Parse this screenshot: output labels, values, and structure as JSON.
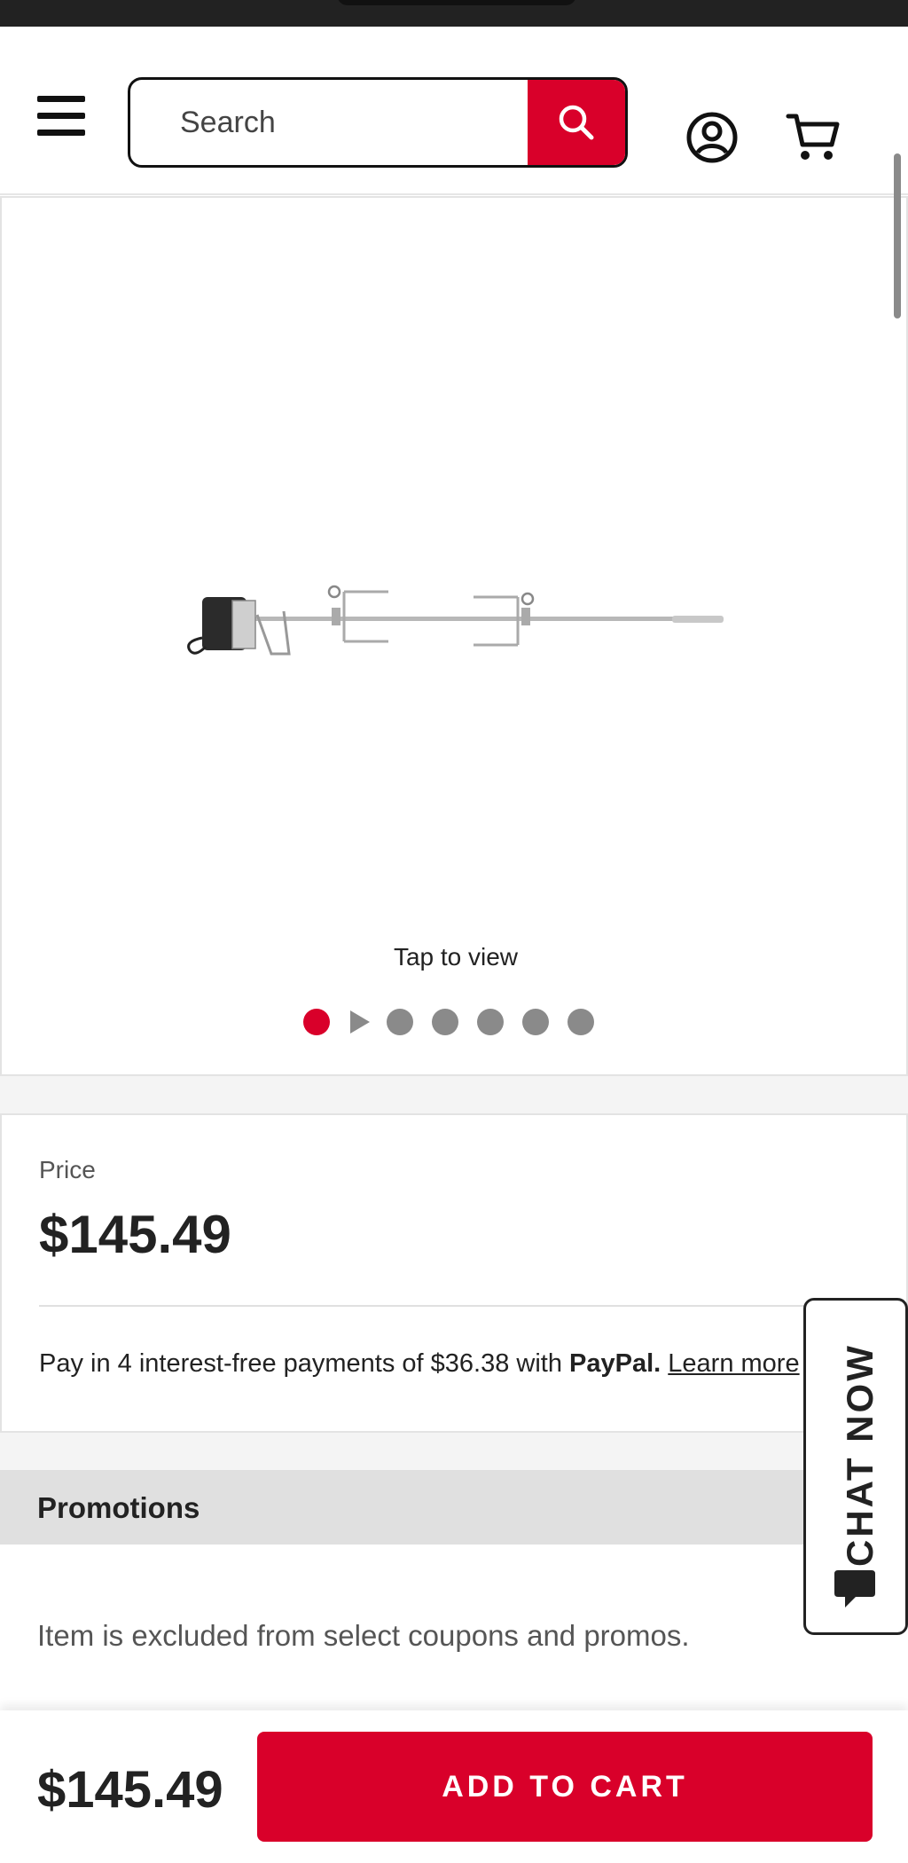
{
  "header": {
    "search_placeholder": "Search"
  },
  "gallery": {
    "tap_label": "Tap to view",
    "slide_count": 7,
    "active_slide": 1
  },
  "price_card": {
    "label": "Price",
    "price": "$145.49",
    "paypal": {
      "prefix": "Pay in 4 interest-free payments of $36.38 with ",
      "brand": "PayPal.",
      "learn_more": "Learn more"
    }
  },
  "promotions": {
    "title": "Promotions",
    "text": "Item is excluded from select coupons and promos."
  },
  "chat": {
    "label": "CHAT NOW"
  },
  "footer": {
    "price": "$145.49",
    "add_to_cart": "ADD TO CART"
  },
  "colors": {
    "accent": "#d9002a",
    "dot_inactive": "#8a8a8a",
    "section_gap": "#f4f4f4",
    "promo_header_bg": "#e0e0e0"
  },
  "icons": {
    "menu": "hamburger-menu-icon",
    "search": "search-icon",
    "account": "account-icon",
    "cart": "cart-icon",
    "chat": "chat-bubble-icon",
    "video": "play-icon"
  }
}
